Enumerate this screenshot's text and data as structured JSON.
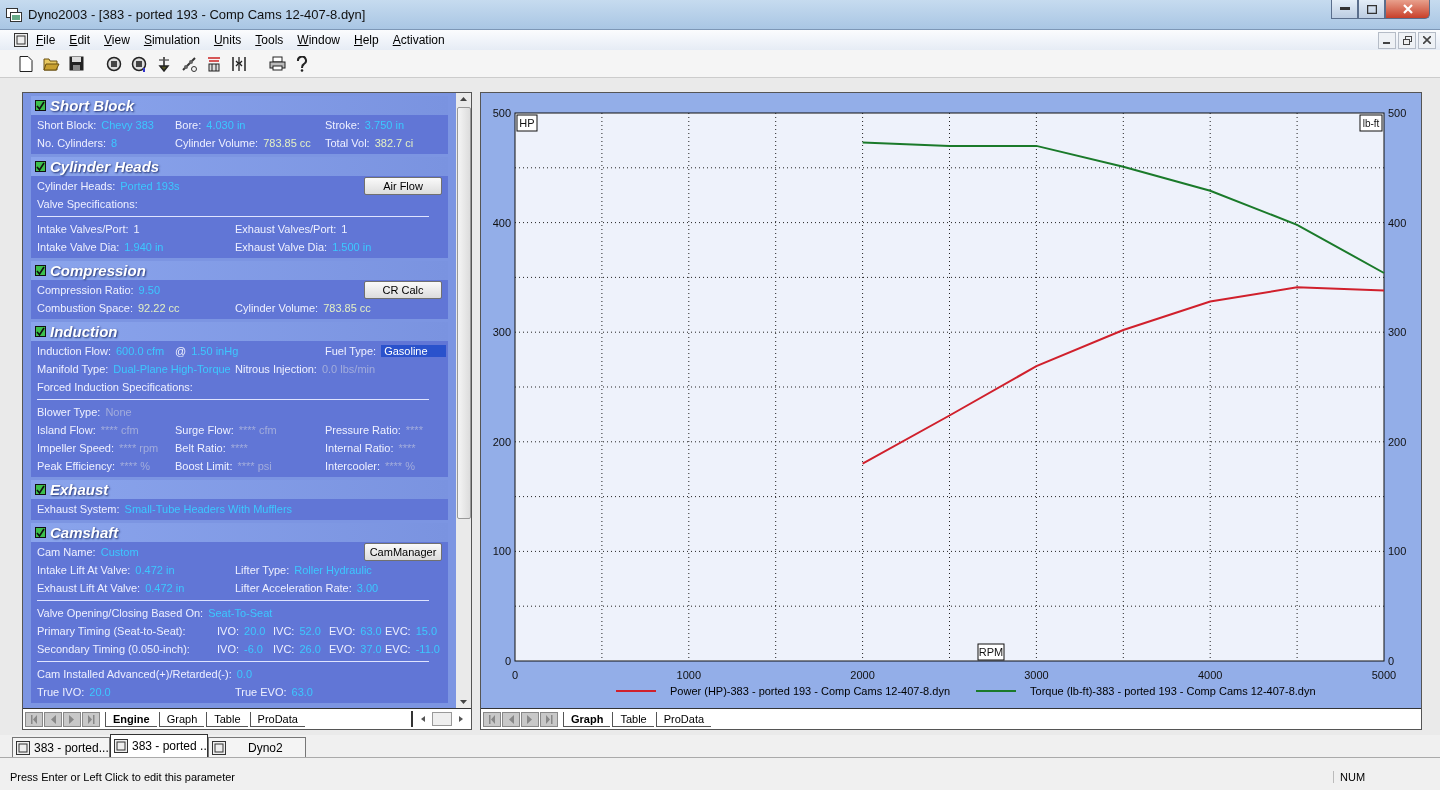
{
  "window": {
    "title": "Dyno2003 - [383 - ported 193 - Comp Cams 12-407-8.dyn]"
  },
  "menu": [
    "File",
    "Edit",
    "View",
    "Simulation",
    "Units",
    "Tools",
    "Window",
    "Help",
    "Activation"
  ],
  "engine_panel": {
    "sections": [
      {
        "title": "Short Block",
        "checked": true,
        "lines": [
          {
            "kind": "fields",
            "fields": [
              {
                "label": "Short Block:",
                "value": "Chevy 383",
                "kind": "input"
              },
              {
                "label": "Bore:",
                "value": "4.030 in",
                "kind": "input"
              },
              {
                "label": "Stroke:",
                "value": "3.750 in",
                "kind": "input"
              }
            ]
          },
          {
            "kind": "fields",
            "fields": [
              {
                "label": "No. Cylinders:",
                "value": "8",
                "kind": "input"
              },
              {
                "label": "Cylinder Volume:",
                "value": "783.85 cc",
                "kind": "computed"
              },
              {
                "label": "Total Vol:",
                "value": "382.7 ci",
                "kind": "computed"
              }
            ]
          }
        ]
      },
      {
        "title": "Cylinder Heads",
        "checked": true,
        "lines": [
          {
            "kind": "fields",
            "fields": [
              {
                "label": "Cylinder Heads:",
                "value": "Ported 193s",
                "kind": "input"
              }
            ],
            "button": "Air Flow"
          },
          {
            "kind": "heading",
            "text": "Valve Specifications:"
          },
          {
            "kind": "divider"
          },
          {
            "kind": "fields",
            "fields": [
              {
                "label": "Intake Valves/Port:",
                "value": "1",
                "kind": "plain"
              },
              {
                "label": "Exhaust Valves/Port:",
                "value": "1",
                "kind": "plain"
              }
            ]
          },
          {
            "kind": "fields",
            "fields": [
              {
                "label": "Intake Valve Dia:",
                "value": "1.940 in",
                "kind": "input"
              },
              {
                "label": "Exhaust Valve Dia:",
                "value": "1.500 in",
                "kind": "input"
              }
            ]
          }
        ]
      },
      {
        "title": "Compression",
        "checked": true,
        "lines": [
          {
            "kind": "fields",
            "fields": [
              {
                "label": "Compression Ratio:",
                "value": "9.50",
                "kind": "input"
              }
            ],
            "button": "CR Calc"
          },
          {
            "kind": "fields",
            "fields": [
              {
                "label": "Combustion Space:",
                "value": "92.22 cc",
                "kind": "computed"
              },
              {
                "label": "Cylinder Volume:",
                "value": "783.85 cc",
                "kind": "computed"
              }
            ]
          }
        ]
      },
      {
        "title": "Induction",
        "checked": true,
        "lines": [
          {
            "kind": "fields",
            "fields": [
              {
                "label": "Induction Flow:",
                "value": "600.0 cfm",
                "kind": "input"
              },
              {
                "label": "@",
                "value": "1.50 inHg",
                "kind": "input"
              },
              {
                "label": "Fuel Type:",
                "value": "Gasoline",
                "kind": "selected"
              }
            ]
          },
          {
            "kind": "fields",
            "fields": [
              {
                "label": "Manifold Type:",
                "value": "Dual-Plane High-Torque",
                "kind": "input"
              },
              {
                "label": "Nitrous Injection:",
                "value": "0.0 lbs/min",
                "kind": "disabled"
              }
            ]
          },
          {
            "kind": "heading",
            "text": "Forced Induction Specifications:"
          },
          {
            "kind": "divider"
          },
          {
            "kind": "fields",
            "fields": [
              {
                "label": "Blower Type:",
                "value": "None",
                "kind": "disabled"
              }
            ]
          },
          {
            "kind": "fields",
            "fields": [
              {
                "label": "Island Flow:",
                "value": "**** cfm",
                "kind": "disabled"
              },
              {
                "label": "Surge Flow:",
                "value": "**** cfm",
                "kind": "disabled"
              },
              {
                "label": "Pressure Ratio:",
                "value": "****",
                "kind": "disabled"
              }
            ]
          },
          {
            "kind": "fields",
            "fields": [
              {
                "label": "Impeller Speed:",
                "value": "**** rpm",
                "kind": "disabled"
              },
              {
                "label": "Belt Ratio:",
                "value": "****",
                "kind": "disabled"
              },
              {
                "label": "Internal Ratio:",
                "value": "****",
                "kind": "disabled"
              }
            ]
          },
          {
            "kind": "fields",
            "fields": [
              {
                "label": "Peak Efficiency:",
                "value": "**** %",
                "kind": "disabled"
              },
              {
                "label": "Boost Limit:",
                "value": "**** psi",
                "kind": "disabled"
              },
              {
                "label": "Intercooler:",
                "value": "**** %",
                "kind": "disabled"
              }
            ]
          }
        ]
      },
      {
        "title": "Exhaust",
        "checked": true,
        "lines": [
          {
            "kind": "fields",
            "fields": [
              {
                "label": "Exhaust System:",
                "value": "Small-Tube Headers With Mufflers",
                "kind": "input"
              }
            ]
          }
        ]
      },
      {
        "title": "Camshaft",
        "checked": true,
        "lines": [
          {
            "kind": "fields",
            "fields": [
              {
                "label": "Cam Name:",
                "value": "Custom",
                "kind": "input"
              }
            ],
            "button": "CamManager"
          },
          {
            "kind": "fields",
            "fields": [
              {
                "label": "Intake Lift At Valve:",
                "value": "0.472 in",
                "kind": "input"
              },
              {
                "label": "Lifter Type:",
                "value": "Roller Hydraulic",
                "kind": "input"
              }
            ]
          },
          {
            "kind": "fields",
            "fields": [
              {
                "label": "Exhaust Lift At Valve:",
                "value": "0.472 in",
                "kind": "input"
              },
              {
                "label": "Lifter Acceleration Rate:",
                "value": "3.00",
                "kind": "input"
              }
            ]
          },
          {
            "kind": "divider"
          },
          {
            "kind": "fields",
            "fields": [
              {
                "label": "Valve Opening/Closing Based On:",
                "value": "Seat-To-Seat",
                "kind": "input"
              }
            ]
          },
          {
            "kind": "timing",
            "label": "Primary Timing  (Seat-to-Seat):",
            "fields": [
              {
                "label": "IVO:",
                "value": "20.0",
                "kind": "input"
              },
              {
                "label": "IVC:",
                "value": "52.0",
                "kind": "input"
              },
              {
                "label": "EVO:",
                "value": "63.0",
                "kind": "input"
              },
              {
                "label": "EVC:",
                "value": "15.0",
                "kind": "input"
              }
            ]
          },
          {
            "kind": "timing",
            "label": "Secondary Timing  (0.050-inch):",
            "fields": [
              {
                "label": "IVO:",
                "value": "-6.0",
                "kind": "input"
              },
              {
                "label": "IVC:",
                "value": "26.0",
                "kind": "input"
              },
              {
                "label": "EVO:",
                "value": "37.0",
                "kind": "input"
              },
              {
                "label": "EVC:",
                "value": "-11.0",
                "kind": "input"
              }
            ]
          },
          {
            "kind": "divider"
          },
          {
            "kind": "fields",
            "fields": [
              {
                "label": "Cam Installed Advanced(+)/Retarded(-):",
                "value": "0.0",
                "kind": "input"
              }
            ]
          },
          {
            "kind": "fields",
            "fields": [
              {
                "label": "True IVO:",
                "value": "20.0",
                "kind": "input"
              },
              {
                "label": "True EVO:",
                "value": "63.0",
                "kind": "input"
              }
            ]
          }
        ]
      }
    ],
    "tabs": [
      {
        "label": "Engine",
        "selected": true
      },
      {
        "label": "Graph",
        "selected": false
      },
      {
        "label": "Table",
        "selected": false
      },
      {
        "label": "ProData",
        "selected": false
      }
    ]
  },
  "graph_panel": {
    "chart_data": {
      "type": "line",
      "x": [
        2000,
        2500,
        3000,
        3500,
        4000,
        4500,
        5000
      ],
      "series": [
        {
          "name": "Power (HP)-383 - ported 193 - Comp Cams 12-407-8.dyn",
          "color": "#d0202c",
          "values": [
            180,
            224,
            269,
            302,
            328,
            341,
            338
          ]
        },
        {
          "name": "Torque (lb-ft)-383 - ported 193 - Comp Cams 12-407-8.dyn",
          "color": "#1a7a2a",
          "values": [
            473,
            470,
            470,
            451,
            429,
            398,
            354
          ]
        }
      ],
      "xlabel": "RPM",
      "ylabel": "HP",
      "y2label": "lb-ft",
      "xlim": [
        0,
        5000
      ],
      "ylim": [
        0,
        500
      ],
      "xticks": [
        0,
        1000,
        2000,
        3000,
        4000,
        5000
      ],
      "yticks": [
        0,
        100,
        200,
        300,
        400,
        500
      ],
      "y2ticks": [
        0,
        100,
        200,
        300,
        400,
        500
      ],
      "y2lim": [
        0,
        500
      ],
      "grid": true,
      "legend": "bottom"
    },
    "tabs": [
      {
        "label": "Graph",
        "selected": true
      },
      {
        "label": "Table",
        "selected": false
      },
      {
        "label": "ProData",
        "selected": false
      }
    ]
  },
  "documents": [
    {
      "label": "383 - ported...",
      "selected": false
    },
    {
      "label": "383 - ported ...",
      "selected": true
    },
    {
      "label": "Dyno2",
      "selected": false
    }
  ],
  "status_bar": {
    "message": "Press Enter or Left Click to edit this parameter",
    "indicator": "NUM"
  }
}
